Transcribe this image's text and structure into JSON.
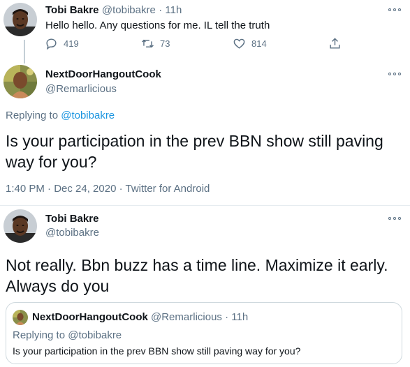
{
  "top_tweet": {
    "name": "Tobi Bakre",
    "handle": "@tobibakre",
    "time": "· 11h",
    "text": "Hello hello. Any questions for me. IL tell the truth",
    "replies": "419",
    "retweets": "73",
    "likes": "814",
    "icons": [
      "reply-icon",
      "retweet-icon",
      "like-icon",
      "share-icon",
      "more-icon"
    ]
  },
  "main_tweet": {
    "name": "NextDoorHangoutCook",
    "handle": "@Remarlicious",
    "replying_prefix": "Replying to",
    "replying_to": "@tobibakre",
    "text": "Is your participation in the prev BBN show still paving way for you?",
    "meta": "1:40 PM · Dec 24, 2020 · Twitter for Android"
  },
  "reply_tweet": {
    "name": "Tobi Bakre",
    "handle": "@tobibakre",
    "text": "Not really. Bbn buzz has a time line. Maximize it early. Always do you"
  },
  "quoted_tweet": {
    "name": "NextDoorHangoutCook",
    "handle": "@Remarlicious",
    "time": "· 11h",
    "replying_prefix": "Replying to",
    "replying_to": "@tobibakre",
    "text": "Is your participation in the prev BBN show still paving way for you?"
  },
  "colors": {
    "text": "#0f1419",
    "muted": "#5b7083",
    "link": "#1b95e0",
    "border": "#cfd9de"
  }
}
